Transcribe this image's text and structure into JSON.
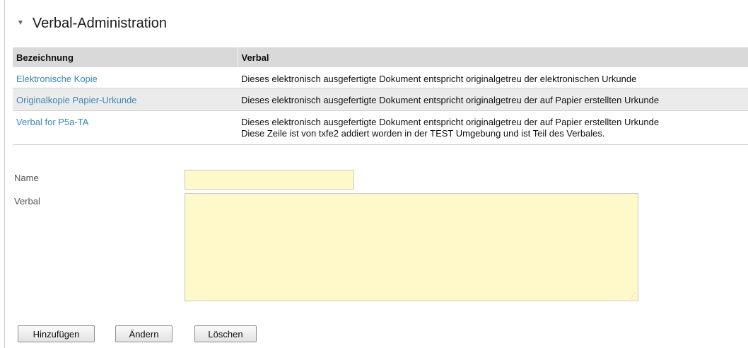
{
  "section": {
    "title": "Verbal-Administration",
    "collapse_icon": "triangle-down-icon"
  },
  "table": {
    "columns": [
      "Bezeichnung",
      "Verbal"
    ],
    "rows": [
      {
        "name": "Elektronische Kopie",
        "verbal": [
          "Dieses elektronisch ausgefertigte Dokument entspricht originalgetreu der elektronischen Urkunde"
        ]
      },
      {
        "name": "Originalkopie Papier-Urkunde",
        "verbal": [
          "Dieses elektronisch ausgefertigte Dokument entspricht originalgetreu der auf Papier erstellten Urkunde"
        ]
      },
      {
        "name": "Verbal for P5a-TA",
        "verbal": [
          "Dieses elektronisch ausgefertigte Dokument entspricht originalgetreu der auf Papier erstellten Urkunde",
          "Diese Zeile ist von txfe2 addiert worden in der TEST Umgebung und ist Teil des Verbales."
        ]
      }
    ]
  },
  "form": {
    "name_label": "Name",
    "name_value": "",
    "verbal_label": "Verbal",
    "verbal_value": ""
  },
  "buttons": {
    "add": "Hinzufügen",
    "edit": "Ändern",
    "delete": "Löschen"
  },
  "colors": {
    "link": "#3b85b5",
    "header_bg": "#d9d9d9",
    "input_bg": "#fff8c8",
    "alt_row_bg": "#ebebeb"
  }
}
